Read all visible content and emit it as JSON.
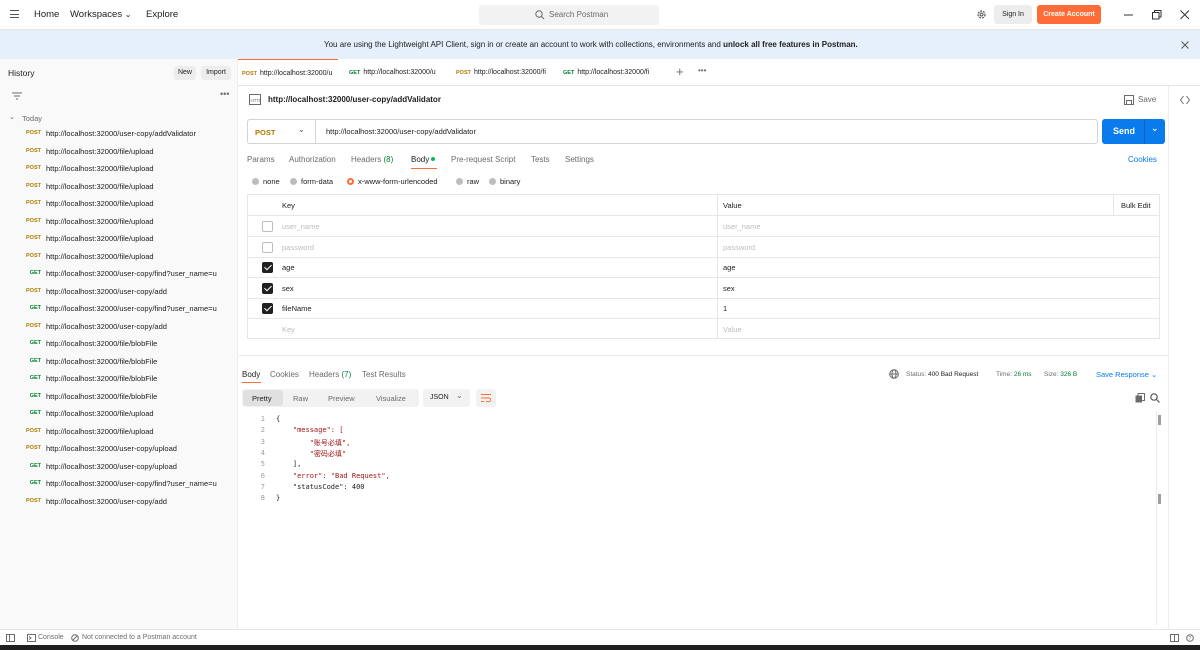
{
  "topbar": {
    "nav": [
      "Home",
      "Workspaces",
      "Explore"
    ],
    "search_placeholder": "Search Postman",
    "sign_in": "Sign In",
    "create_account": "Create Account"
  },
  "banner": {
    "message": "You are using the Lightweight API Client, sign in or create an account to work with collections, environments and",
    "message_bold": "unlock all free features in Postman."
  },
  "sidebar": {
    "title": "History",
    "new_label": "New",
    "import_label": "Import",
    "group_label": "Today",
    "items": [
      {
        "method": "POST",
        "url": "http://localhost:32000/user-copy/addValidator"
      },
      {
        "method": "POST",
        "url": "http://localhost:32000/file/upload"
      },
      {
        "method": "POST",
        "url": "http://localhost:32000/file/upload"
      },
      {
        "method": "POST",
        "url": "http://localhost:32000/file/upload"
      },
      {
        "method": "POST",
        "url": "http://localhost:32000/file/upload"
      },
      {
        "method": "POST",
        "url": "http://localhost:32000/file/upload"
      },
      {
        "method": "POST",
        "url": "http://localhost:32000/file/upload"
      },
      {
        "method": "POST",
        "url": "http://localhost:32000/file/upload"
      },
      {
        "method": "GET",
        "url": "http://localhost:32000/user-copy/find?user_name=u"
      },
      {
        "method": "POST",
        "url": "http://localhost:32000/user-copy/add"
      },
      {
        "method": "GET",
        "url": "http://localhost:32000/user-copy/find?user_name=u"
      },
      {
        "method": "POST",
        "url": "http://localhost:32000/user-copy/add"
      },
      {
        "method": "GET",
        "url": "http://localhost:32000/file/blobFile"
      },
      {
        "method": "GET",
        "url": "http://localhost:32000/file/blobFile"
      },
      {
        "method": "GET",
        "url": "http://localhost:32000/file/blobFile"
      },
      {
        "method": "GET",
        "url": "http://localhost:32000/file/blobFile"
      },
      {
        "method": "GET",
        "url": "http://localhost:32000/file/upload"
      },
      {
        "method": "POST",
        "url": "http://localhost:32000/file/upload"
      },
      {
        "method": "POST",
        "url": "http://localhost:32000/user-copy/upload"
      },
      {
        "method": "GET",
        "url": "http://localhost:32000/user-copy/upload"
      },
      {
        "method": "GET",
        "url": "http://localhost:32000/user-copy/find?user_name=u"
      },
      {
        "method": "POST",
        "url": "http://localhost:32000/user-copy/add"
      }
    ]
  },
  "tabs": [
    {
      "method": "POST",
      "url": "http://localhost:32000/u",
      "active": true
    },
    {
      "method": "GET",
      "url": "http://localhost:32000/u",
      "active": false
    },
    {
      "method": "POST",
      "url": "http://localhost:32000/fi",
      "active": false
    },
    {
      "method": "GET",
      "url": "http://localhost:32000/fi",
      "active": false
    }
  ],
  "request": {
    "title": "http://localhost:32000/user-copy/addValidator",
    "save_label": "Save",
    "method": "POST",
    "url": "http://localhost:32000/user-copy/addValidator",
    "send_label": "Send",
    "subtabs": [
      "Params",
      "Authorization",
      "Headers",
      "Body",
      "Pre-request Script",
      "Tests",
      "Settings"
    ],
    "headers_count": "(8)",
    "cookies_label": "Cookies",
    "body_types": [
      "none",
      "form-data",
      "x-www-form-urlencoded",
      "raw",
      "binary"
    ],
    "table": {
      "key_header": "Key",
      "value_header": "Value",
      "bulk_edit": "Bulk Edit",
      "rows": [
        {
          "checked": false,
          "key": "user_name",
          "value": "user_name",
          "dim": true
        },
        {
          "checked": false,
          "key": "password",
          "value": "password",
          "dim": true
        },
        {
          "checked": true,
          "key": "age",
          "value": "age",
          "dim": false
        },
        {
          "checked": true,
          "key": "sex",
          "value": "sex",
          "dim": false
        },
        {
          "checked": true,
          "key": "fileName",
          "value": "1",
          "dim": false
        }
      ],
      "placeholder_key": "Key",
      "placeholder_value": "Value"
    }
  },
  "response": {
    "tabs": [
      "Body",
      "Cookies",
      "Headers",
      "Test Results"
    ],
    "headers_count": "(7)",
    "status_label": "Status:",
    "status": "400 Bad Request",
    "time_label": "Time:",
    "time": "26 ms",
    "size_label": "Size:",
    "size": "326 B",
    "save_response": "Save Response",
    "views": [
      "Pretty",
      "Raw",
      "Preview",
      "Visualize"
    ],
    "format": "JSON",
    "code_lines": [
      "{",
      "    \"message\": [",
      "        \"账号必填\",",
      "        \"密码必填\"",
      "    ],",
      "    \"error\": \"Bad Request\",",
      "    \"statusCode\": 400",
      "}"
    ]
  },
  "footer": {
    "console": "Console",
    "status": "Not connected to a Postman account"
  },
  "colors": {
    "accent": "#ff6c37",
    "send": "#097bed",
    "post": "#ad7a03",
    "get": "#007f31",
    "banner_bg": "#e6f0fb"
  }
}
